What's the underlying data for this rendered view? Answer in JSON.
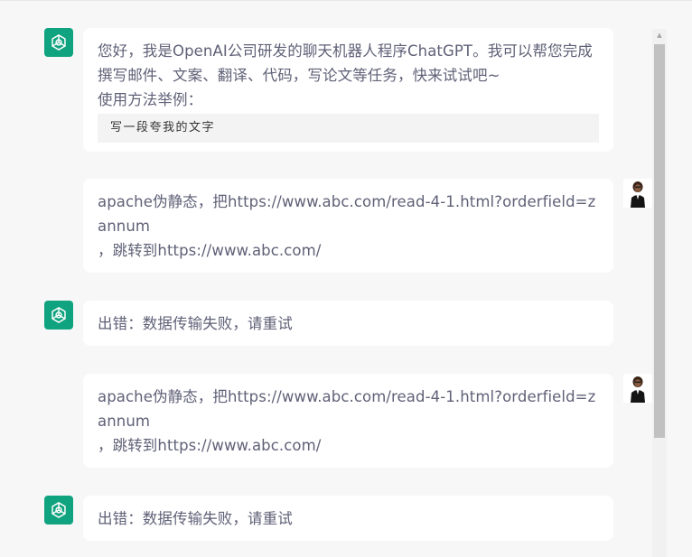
{
  "conversation": {
    "welcome": {
      "line1": "您好，我是OpenAI公司研发的聊天机器人程序ChatGPT。我可以帮您完成撰写邮件、文案、翻译、代码，写论文等任务，快来试试吧~",
      "line2": "使用方法举例：",
      "example": "写一段夸我的文字"
    },
    "messages": [
      {
        "role": "user",
        "line1": "apache伪静态，把https://www.abc.com/read-4-1.html?orderfield=zannum",
        "line2": "，跳转到https://www.abc.com/"
      },
      {
        "role": "bot",
        "text": "出错：数据传输失败，请重试"
      },
      {
        "role": "user",
        "line1": "apache伪静态，把https://www.abc.com/read-4-1.html?orderfield=zannum",
        "line2": "，跳转到https://www.abc.com/"
      },
      {
        "role": "bot",
        "text": "出错：数据传输失败，请重试"
      }
    ]
  },
  "icons": {
    "bot_avatar": "openai-logo-icon",
    "user_avatar": "user-avatar-icon",
    "scroll_up": "scroll-up-arrow-icon"
  },
  "colors": {
    "bot_avatar_bg": "#10a37f",
    "text": "#5f6177",
    "background": "#f7f7f8",
    "bubble": "#ffffff"
  }
}
